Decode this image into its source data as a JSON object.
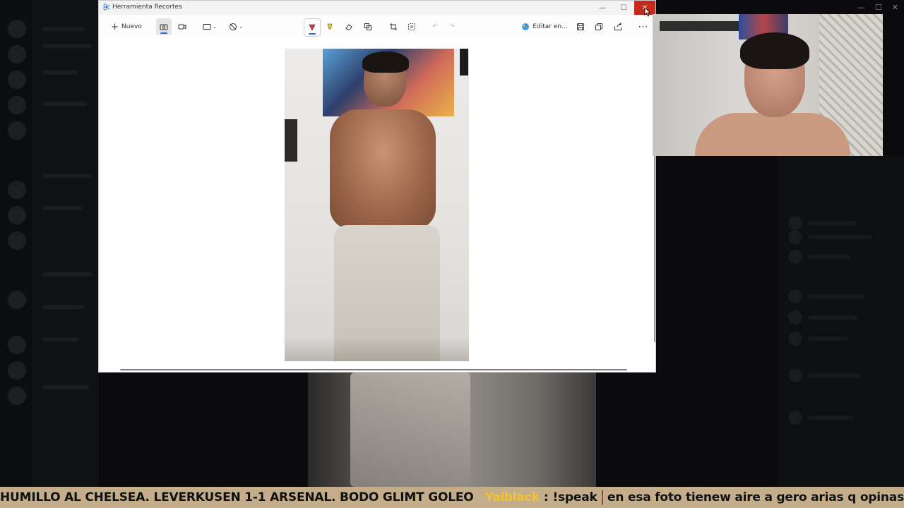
{
  "snip_window": {
    "title": "Herramienta Recortes",
    "toolbar": {
      "new_label": "Nuevo",
      "edit_in_label": "Editar en...",
      "icons": [
        "camera-icon",
        "video-icon",
        "rectangle-mode-icon",
        "no-delay-icon",
        "pen-icon",
        "highlighter-icon",
        "eraser-icon",
        "shapes-icon",
        "crop-icon",
        "text-actions-icon",
        "undo-icon",
        "redo-icon",
        "paint-app-icon",
        "save-icon",
        "copy-icon",
        "share-icon",
        "more-icon"
      ]
    },
    "window_controls": [
      "minimize",
      "maximize",
      "close"
    ]
  },
  "ticker": {
    "headline": "HUMILLO AL CHELSEA. LEVERKUSEN 1-1 ARSENAL. BODO GLIMT GOLEO",
    "username": "Yaiblack",
    "message_prefix": "!speak",
    "message": "en esa foto tienew aire a gero arias q opinas",
    "background_color": "#c4ad8a",
    "username_color": "#f2c230"
  }
}
